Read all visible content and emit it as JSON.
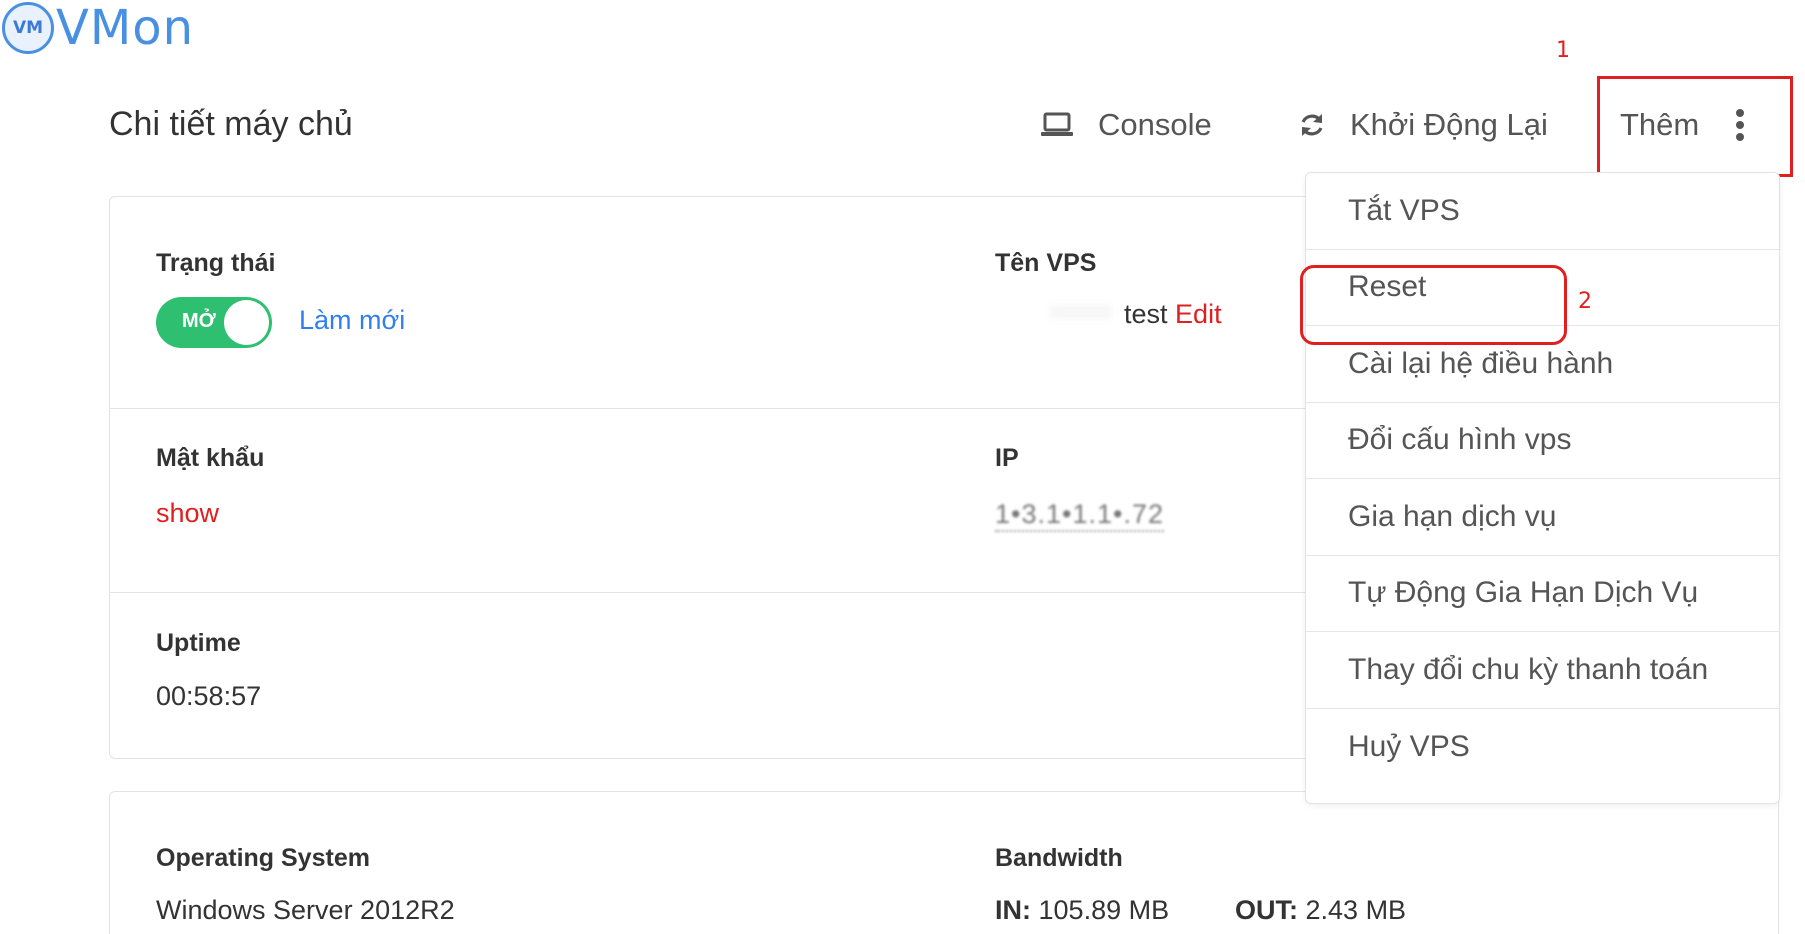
{
  "logo": {
    "badge": "VM",
    "text": "VMon"
  },
  "header": {
    "title": "Chi tiết máy chủ",
    "console_label": "Console",
    "reboot_label": "Khởi Động Lại",
    "more_label": "Thêm"
  },
  "annotations": {
    "step1": "1",
    "step2": "2"
  },
  "details": {
    "status": {
      "label": "Trạng thái",
      "toggle_label": "MỞ",
      "refresh_link": "Làm mới"
    },
    "vps_name": {
      "label": "Tên VPS",
      "value": "test",
      "edit_link": "Edit"
    },
    "password": {
      "label": "Mật khẩu",
      "show_link": "show"
    },
    "ip": {
      "label": "IP",
      "value": "1•3.1•1.1•.72"
    },
    "uptime": {
      "label": "Uptime",
      "value": "00:58:57"
    }
  },
  "system": {
    "os": {
      "label": "Operating System",
      "value": "Windows Server 2012R2"
    },
    "bandwidth": {
      "label": "Bandwidth",
      "in_label": "IN:",
      "in_value": "105.89 MB",
      "out_label": "OUT:",
      "out_value": "2.43 MB"
    }
  },
  "dropdown": {
    "items": [
      "Tắt VPS",
      "Reset",
      "Cài lại hệ điều hành",
      "Đổi cấu hình vps",
      "Gia hạn dịch vụ",
      "Tự Động Gia Hạn Dịch Vụ",
      "Thay đổi chu kỳ thanh toán",
      "Huỷ VPS"
    ]
  },
  "colors": {
    "accent_blue": "#2f80ed",
    "toggle_green": "#2fbf71",
    "annotation_red": "#e02020"
  },
  "icons": {
    "console": "laptop-icon",
    "reboot": "refresh-icon",
    "more": "vertical-dots-icon"
  }
}
